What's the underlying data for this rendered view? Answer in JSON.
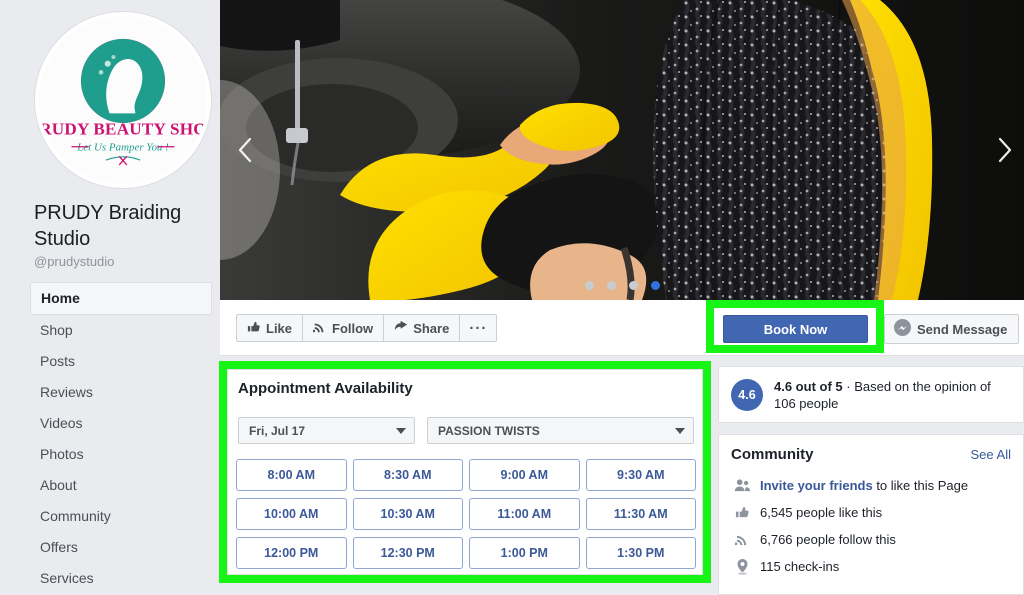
{
  "profile": {
    "logo_alt": "Prudy Beauty Shop logo",
    "logo_brand_text": "PRUDY BEAUTY SHOP",
    "logo_tagline": "Let Us Pamper You !",
    "name": "PRUDY Braiding Studio",
    "handle": "@prudystudio"
  },
  "sidebar": {
    "items": [
      {
        "label": "Home",
        "active": true
      },
      {
        "label": "Shop",
        "active": false
      },
      {
        "label": "Posts",
        "active": false
      },
      {
        "label": "Reviews",
        "active": false
      },
      {
        "label": "Videos",
        "active": false
      },
      {
        "label": "Photos",
        "active": false
      },
      {
        "label": "About",
        "active": false
      },
      {
        "label": "Community",
        "active": false
      },
      {
        "label": "Offers",
        "active": false
      },
      {
        "label": "Services",
        "active": false
      }
    ]
  },
  "cover": {
    "prev_icon": "chevron-left-icon",
    "next_icon": "chevron-right-icon",
    "dot_count": 4,
    "active_dot_index": 3
  },
  "action_bar": {
    "like_label": "Like",
    "follow_label": "Follow",
    "share_label": "Share",
    "more_label": "···",
    "book_now_label": "Book Now",
    "send_message_label": "Send Message",
    "book_now_color": "#4267b2",
    "highlight_color": "#16f516"
  },
  "appointment": {
    "title": "Appointment Availability",
    "date_value": "Fri, Jul 17",
    "service_value": "PASSION TWISTS",
    "slots": [
      "8:00 AM",
      "8:30 AM",
      "9:00 AM",
      "9:30 AM",
      "10:00 AM",
      "10:30 AM",
      "11:00 AM",
      "11:30 AM",
      "12:00 PM",
      "12:30 PM",
      "1:00 PM",
      "1:30 PM"
    ],
    "slot_color": "#3b5998"
  },
  "rating": {
    "score_badge": "4.6",
    "headline": "4.6 out of 5",
    "separator": " · ",
    "detail": "Based on the opinion of 106 people"
  },
  "community": {
    "title": "Community",
    "see_all_label": "See All",
    "invite_link_label": "Invite your friends",
    "invite_suffix": " to like this Page",
    "likes_label": "6,545 people like this",
    "follows_label": "6,766 people follow this",
    "checkins_label": "115 check-ins"
  }
}
